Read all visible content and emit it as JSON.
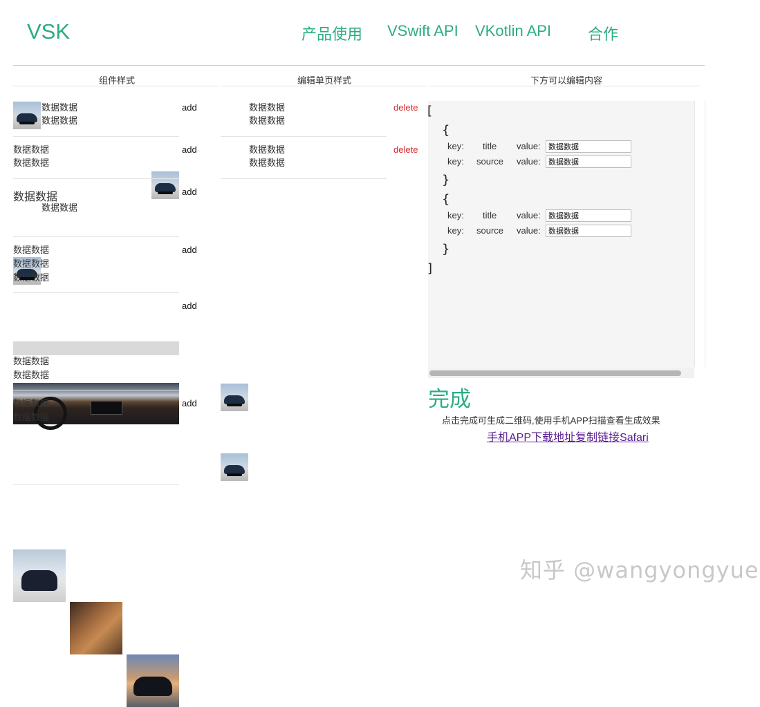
{
  "header": {
    "logo": "VSK",
    "nav": [
      "产品使用",
      "VSwift API",
      "VKotlin API",
      "合作"
    ]
  },
  "columns": {
    "components": "组件样式",
    "edit_page": "编辑单页样式",
    "editable": "下方可以编辑内容"
  },
  "sample_text": "数据数据",
  "actions": {
    "add": "add",
    "delete": "delete"
  },
  "editor": {
    "open_bracket": "[",
    "close_bracket": "]",
    "open_brace": "{",
    "close_brace": "}",
    "key_label": "key:",
    "value_label": "value:",
    "objects": [
      {
        "fields": [
          {
            "key": "title",
            "value": "数据数据"
          },
          {
            "key": "source",
            "value": "数据数据"
          }
        ]
      },
      {
        "fields": [
          {
            "key": "title",
            "value": "数据数据"
          },
          {
            "key": "source",
            "value": "数据数据"
          }
        ]
      }
    ]
  },
  "done": {
    "label": "完成",
    "hint": "点击完成可生成二维码,使用手机APP扫描查看生成效果",
    "link": "手机APP下载地址复制链接Safari"
  },
  "watermark": "知乎 @wangyongyue"
}
